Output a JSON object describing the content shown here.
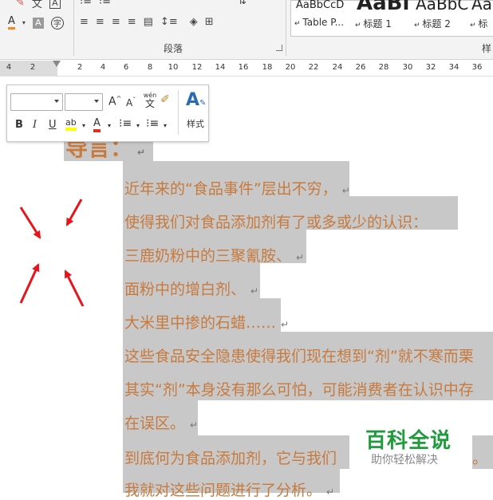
{
  "ribbon": {
    "paragraph_group_label": "段落",
    "styles_group_label": "样",
    "font_group": {
      "highlight_char_icon": "A",
      "phonetic_icon": "字"
    },
    "styles": [
      {
        "sample": "AaBbCcD",
        "name": "Table P..."
      },
      {
        "sample": "AaBl",
        "name": "标题 1"
      },
      {
        "sample": "AaBbC",
        "name": "标题 2"
      },
      {
        "sample": "AaB",
        "name": "标"
      }
    ]
  },
  "ruler": {
    "numbers": [
      "4",
      "2",
      "2",
      "4",
      "6",
      "8",
      "10",
      "12",
      "14",
      "16",
      "18",
      "20",
      "22",
      "24",
      "26",
      "28",
      "30",
      "32",
      "34",
      "36"
    ]
  },
  "mini_toolbar": {
    "font_name": "",
    "font_size": "",
    "grow_font": "A",
    "shrink_font": "A",
    "phonetic": "wén",
    "phonetic_char": "文",
    "bold": "B",
    "italic": "I",
    "underline": "U",
    "highlight": "ab",
    "font_color": "A",
    "styles_label": "样式"
  },
  "document": {
    "heading": "导言：",
    "lines": [
      "近年来的“食品事件”层出不穷，",
      "使得我们对食品添加剂有了或多或少的认识：",
      "三鹿奶粉中的三聚氰胺、",
      "面粉中的增白剂、",
      "大米里中掺的石蜡……",
      "这些食品安全隐患使得我们现在想到“剂”就不寒而栗",
      "其实“剂”本身没有那么可怕，可能消费者在认识中存",
      "在误区。",
      "到底何为食品添加剂，它与我们",
      "我就对这些问题进行了分析。"
    ],
    "trailing_period_line9": "。",
    "paragraph_mark": "↵"
  },
  "watermark": {
    "title": "百科全说",
    "subtitle": "助你轻松解决"
  },
  "colors": {
    "text_orange": "#c77a3e",
    "selection_gray": "#c8c8c8",
    "arrow_red": "#e8141c",
    "watermark_green": "#1f9a3c"
  }
}
